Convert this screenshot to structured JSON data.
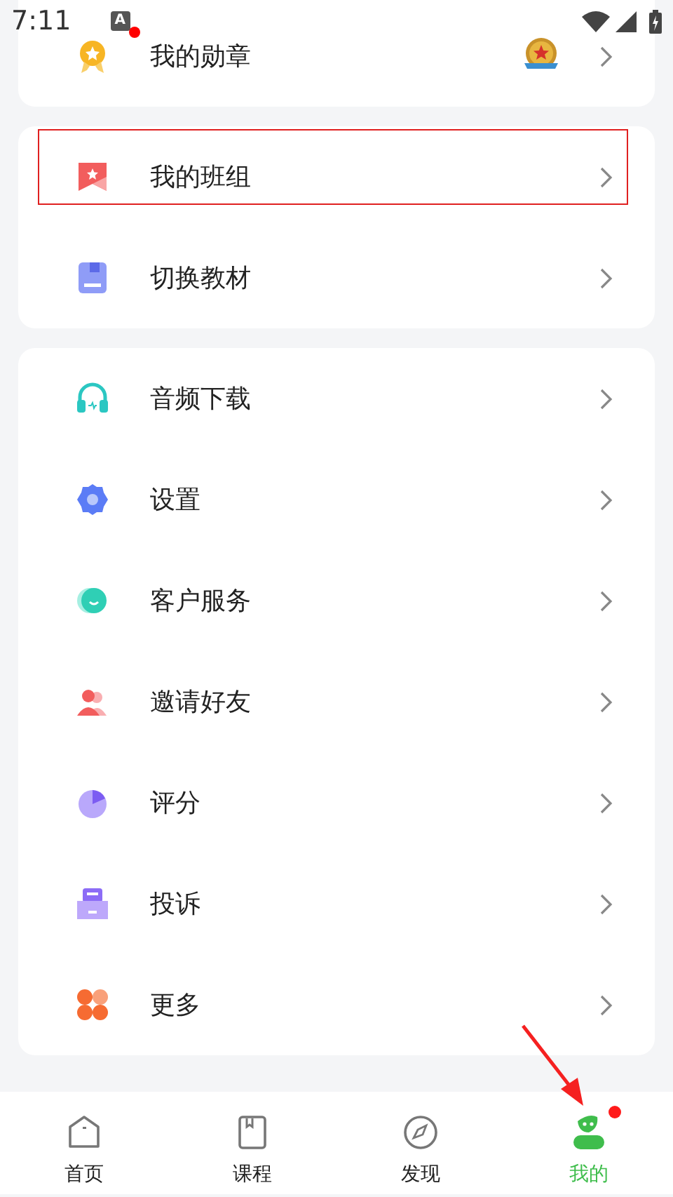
{
  "status_bar": {
    "time": "7:11",
    "input_indicator": "A",
    "notification_dot": true
  },
  "groups": [
    {
      "items": [
        {
          "label": "我的勋章",
          "medal": true,
          "highlighted": false
        }
      ]
    },
    {
      "items": [
        {
          "label": "我的班组",
          "medal": false,
          "highlighted": true
        },
        {
          "label": "切换教材",
          "medal": false,
          "highlighted": false
        }
      ]
    },
    {
      "items": [
        {
          "label": "音频下载",
          "medal": false,
          "highlighted": false
        },
        {
          "label": "设置",
          "medal": false,
          "highlighted": false
        },
        {
          "label": "客户服务",
          "medal": false,
          "highlighted": false
        },
        {
          "label": "邀请好友",
          "medal": false,
          "highlighted": false
        },
        {
          "label": "评分",
          "medal": false,
          "highlighted": false
        },
        {
          "label": "投诉",
          "medal": false,
          "highlighted": false
        },
        {
          "label": "更多",
          "medal": false,
          "highlighted": false
        }
      ]
    }
  ],
  "tabs": [
    {
      "label": "首页",
      "selected": false,
      "badge_dot": false,
      "arrow": false
    },
    {
      "label": "课程",
      "selected": false,
      "badge_dot": false,
      "arrow": false
    },
    {
      "label": "发现",
      "selected": false,
      "badge_dot": false,
      "arrow": false
    },
    {
      "label": "我的",
      "selected": true,
      "badge_dot": true,
      "arrow": true
    }
  ]
}
